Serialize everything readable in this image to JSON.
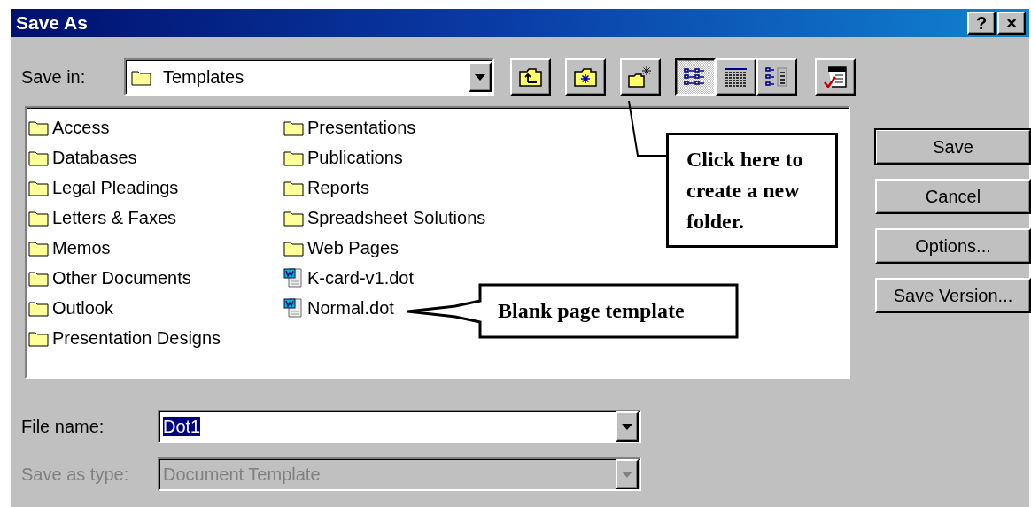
{
  "window": {
    "title": "Save As",
    "buttons": [
      "?",
      "×"
    ]
  },
  "save_in": {
    "label": "Save in:",
    "value": "Templates"
  },
  "toolbar": [
    {
      "kind": "up",
      "selected": false
    },
    {
      "kind": "search",
      "selected": false
    },
    {
      "kind": "new-folder",
      "selected": false
    },
    {
      "kind": "list",
      "selected": true
    },
    {
      "kind": "details",
      "selected": false
    },
    {
      "kind": "properties",
      "selected": false
    },
    {
      "kind": "tools",
      "selected": false
    }
  ],
  "files": [
    {
      "kind": "folder",
      "name": "Access"
    },
    {
      "kind": "folder",
      "name": "Databases"
    },
    {
      "kind": "folder",
      "name": "Legal Pleadings"
    },
    {
      "kind": "folder",
      "name": "Letters & Faxes"
    },
    {
      "kind": "folder",
      "name": "Memos"
    },
    {
      "kind": "folder",
      "name": "Other Documents"
    },
    {
      "kind": "folder",
      "name": "Outlook"
    },
    {
      "kind": "folder",
      "name": "Presentation Designs"
    },
    {
      "kind": "folder",
      "name": "Presentations"
    },
    {
      "kind": "folder",
      "name": "Publications"
    },
    {
      "kind": "folder",
      "name": "Reports"
    },
    {
      "kind": "folder",
      "name": "Spreadsheet Solutions"
    },
    {
      "kind": "folder",
      "name": "Web Pages"
    },
    {
      "kind": "document",
      "name": "K-card-v1.dot"
    },
    {
      "kind": "document",
      "name": "Normal.dot"
    }
  ],
  "file_name": {
    "label": "File name:",
    "value": "Dot1",
    "value_selected": true,
    "disabled": false
  },
  "save_as_type": {
    "label": "Save as type:",
    "value": "Document Template",
    "value_selected": false,
    "disabled": true
  },
  "buttons": [
    {
      "label": "Save",
      "default": true
    },
    {
      "label": "Cancel",
      "default": false
    },
    {
      "label": "Options...",
      "default": false
    },
    {
      "label": "Save Version...",
      "default": false
    }
  ],
  "callouts": [
    {
      "kind": "leader",
      "text": "Click here to create a new folder."
    },
    {
      "kind": "arrow",
      "text": "Blank page template"
    }
  ]
}
